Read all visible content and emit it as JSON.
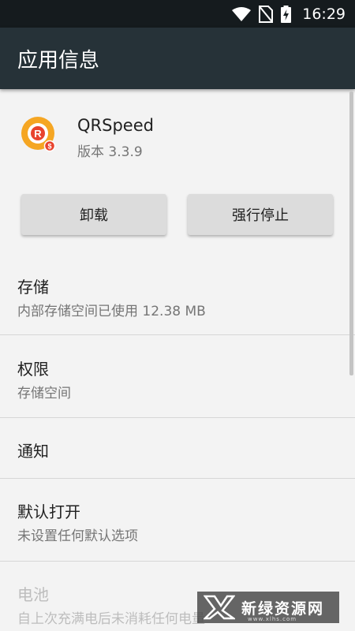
{
  "status_bar": {
    "time": "16:29",
    "icons": [
      "wifi-icon",
      "no-sim-icon",
      "battery-charging-icon"
    ]
  },
  "app_bar": {
    "title": "应用信息"
  },
  "app": {
    "name": "QRSpeed",
    "version": "版本 3.3.9",
    "icon": "qrspeed-app-icon"
  },
  "buttons": {
    "uninstall": "卸载",
    "force_stop": "强行停止"
  },
  "prefs": [
    {
      "title": "存储",
      "summary": "内部存储空间已使用 12.38 MB",
      "enabled": true
    },
    {
      "title": "权限",
      "summary": "存储空间",
      "enabled": true
    },
    {
      "title": "通知",
      "summary": "",
      "enabled": true
    },
    {
      "title": "默认打开",
      "summary": "未设置任何默认选项",
      "enabled": true
    },
    {
      "title": "电池",
      "summary": "自上次充满电后未消耗任何电量",
      "enabled": false
    }
  ],
  "watermark": {
    "text": "新绿资源网",
    "sub": "www.xlhs.com"
  },
  "colors": {
    "status_bar": "#151b1e",
    "app_bar": "#263238",
    "background": "#f3f3f3",
    "button": "#dcdcdc",
    "icon_accent": "#f5a623"
  }
}
